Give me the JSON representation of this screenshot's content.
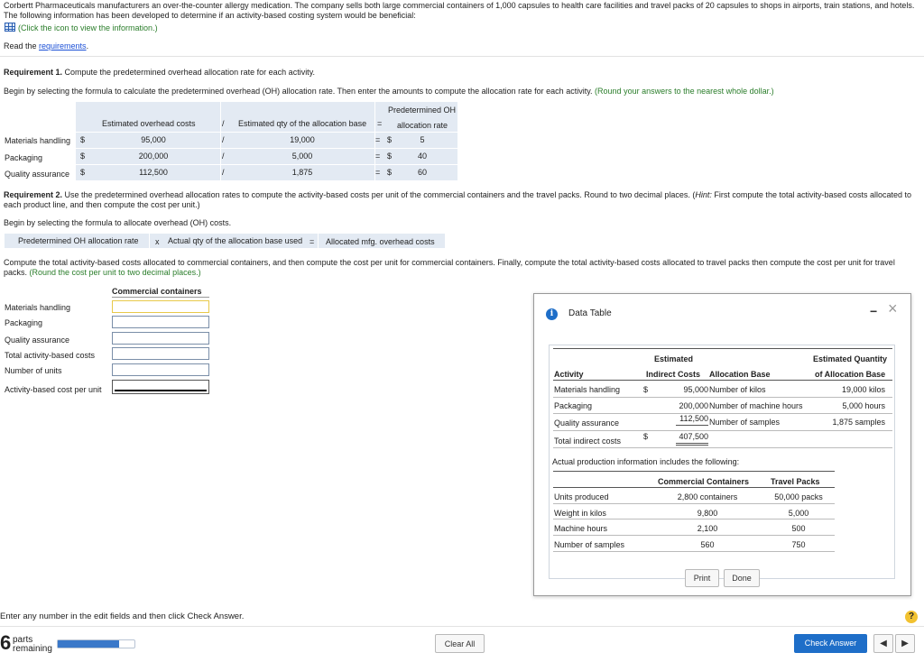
{
  "intro": {
    "line1": "Corbertt Pharmaceuticals manufacturers an over-the-counter allergy medication. The company sells both large commercial containers of 1,000 capsules to health care facilities and travel packs of 20 capsules to shops in airports, train stations, and hotels.",
    "line2": "The following information has been developed to determine if an activity-based costing system would be beneficial:",
    "click_icon": "(Click the icon to view the information.)",
    "read_the": "Read the ",
    "requirements_link": "requirements"
  },
  "req1": {
    "heading_bold": "Requirement 1.",
    "heading_rest": " Compute the predetermined overhead allocation rate for each activity.",
    "instruction": "Begin by selecting the formula to calculate the predetermined overhead (OH) allocation rate. Then enter the amounts to compute the allocation rate for each activity.",
    "instruction_green": "(Round your answers to the nearest whole dollar.)",
    "header_predetermined": "Predetermined OH",
    "header_est_oh": "Estimated overhead costs",
    "header_slash": "/",
    "header_est_qty": "Estimated qty of the allocation base",
    "header_eq": "=",
    "header_alloc_rate": "allocation rate",
    "rows": [
      {
        "label": "Materials handling",
        "dollar": "$",
        "cost": "95,000",
        "slash": "/",
        "qty": "19,000",
        "eq": "=",
        "dollar2": "$",
        "rate": "5"
      },
      {
        "label": "Packaging",
        "dollar": "$",
        "cost": "200,000",
        "slash": "/",
        "qty": "5,000",
        "eq": "=",
        "dollar2": "$",
        "rate": "40"
      },
      {
        "label": "Quality assurance",
        "dollar": "$",
        "cost": "112,500",
        "slash": "/",
        "qty": "1,875",
        "eq": "=",
        "dollar2": "$",
        "rate": "60"
      }
    ]
  },
  "req2": {
    "heading_bold": "Requirement 2.",
    "heading_rest": " Use the predetermined overhead allocation rates to compute the activity-based costs per unit of the commercial containers and the travel packs. Round to two decimal places. (",
    "hint_italic": "Hint:",
    "heading_rest2": " First compute the total activity-based costs allocated to",
    "heading_line2": "each product line, and then compute the cost per unit.)",
    "formula_intro": "Begin by selecting the formula to allocate overhead (OH) costs.",
    "formula_rate": "Predetermined OH allocation rate",
    "formula_x": "x",
    "formula_qty": "Actual qty of the allocation base used",
    "formula_eq": "=",
    "formula_result": "Allocated mfg. overhead costs",
    "compute_line1": "Compute the total activity-based costs allocated to commercial containers, and then compute the cost per unit for commercial containers. Finally, compute the total activity-based costs allocated to travel packs then compute the cost per unit for travel",
    "compute_line2_a": "packs. ",
    "compute_line2_green": "(Round the cost per unit to two decimal places.)",
    "cc_header": "Commercial containers",
    "cc_rows": [
      "Materials handling",
      "Packaging",
      "Quality assurance",
      "Total activity-based costs",
      "Number of units",
      "Activity-based cost per unit"
    ]
  },
  "popup": {
    "title": "Data Table",
    "minimize": "−",
    "close": "×",
    "t1": {
      "h_estimated": "Estimated",
      "h_est_qty": "Estimated Quantity",
      "h_activity": "Activity",
      "h_indirect": "Indirect Costs",
      "h_alloc_base": "Allocation Base",
      "h_of_alloc": "of Allocation Base",
      "rows": [
        {
          "activity": "Materials handling",
          "dollar": "$",
          "cost": "95,000",
          "base": "Number of kilos",
          "qty": "19,000 kilos"
        },
        {
          "activity": "Packaging",
          "dollar": "",
          "cost": "200,000",
          "base": "Number of machine hours",
          "qty": "5,000 hours"
        },
        {
          "activity": "Quality assurance",
          "dollar": "",
          "cost": "112,500",
          "base": "Number of samples",
          "qty": "1,875 samples"
        }
      ],
      "total_label": "Total indirect costs",
      "total_dollar": "$",
      "total_value": "407,500"
    },
    "actual_intro": "Actual production information includes the following:",
    "t2": {
      "h_cc": "Commercial Containers",
      "h_tp": "Travel Packs",
      "rows": [
        {
          "label": "Units produced",
          "cc": "2,800 containers",
          "tp": "50,000 packs"
        },
        {
          "label": "Weight in kilos",
          "cc": "9,800",
          "tp": "5,000"
        },
        {
          "label": "Machine hours",
          "cc": "2,100",
          "tp": "500"
        },
        {
          "label": "Number of samples",
          "cc": "560",
          "tp": "750"
        }
      ]
    },
    "print": "Print",
    "done": "Done"
  },
  "footer": {
    "instruction": "Enter any number in the edit fields and then click Check Answer.",
    "parts_number": "6",
    "parts_word": "parts",
    "remaining": "remaining",
    "progress": 0.8,
    "clear_all": "Clear All",
    "check_answer": "Check Answer",
    "help": "?",
    "prev": "◀",
    "next": "▶"
  }
}
